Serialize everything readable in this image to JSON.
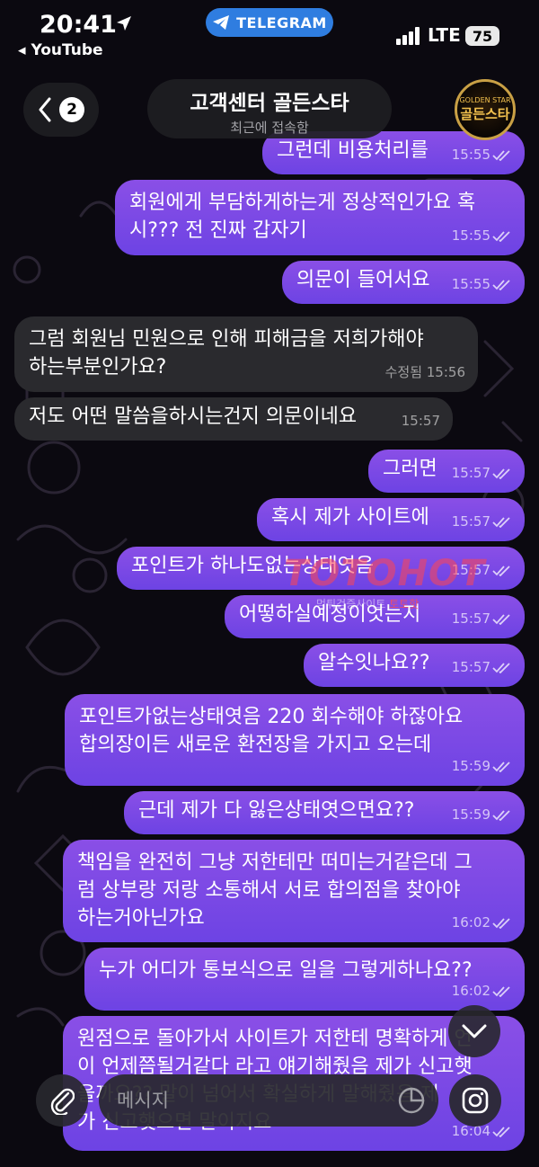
{
  "status_bar": {
    "time": "20:41",
    "back_app": "◂ YouTube",
    "telegram_label": "TELEGRAM",
    "network": "LTE",
    "battery": "75"
  },
  "header": {
    "back_count": "2",
    "title": "고객센터 골든스타",
    "subtitle": "최근에 접속함",
    "avatar_text": "골든스타",
    "avatar_top_text": "GOLDEN STAR"
  },
  "watermark": {
    "main": "TOTOHOT",
    "sub": "먹튀검증사이트",
    "sub2": "토토핫"
  },
  "messages": [
    {
      "dir": "out",
      "text": "그런데 비용처리를",
      "time": "15:55",
      "check": true
    },
    {
      "dir": "out",
      "text": "회원에게 부담하게하는게 정상적인가요 혹\n시??? 전 진짜 갑자기",
      "time": "15:55",
      "check": true
    },
    {
      "dir": "out",
      "text": "의문이 들어서요",
      "time": "15:55",
      "check": true
    },
    {
      "dir": "in",
      "text": "그럼 회원님 민원으로 인해 피해금을 저희가해야\n하는부분인가요?",
      "time": "수정됨 15:56",
      "check": false
    },
    {
      "dir": "in",
      "text": "저도 어떤 말씀을하시는건지 의문이네요",
      "time": "15:57",
      "check": false
    },
    {
      "dir": "out",
      "text": "그러면",
      "time": "15:57",
      "check": true
    },
    {
      "dir": "out",
      "text": "혹시 제가 사이트에",
      "time": "15:57",
      "check": true
    },
    {
      "dir": "out",
      "text": "포인트가 하나도없는상태엿음",
      "time": "15:57",
      "check": true
    },
    {
      "dir": "out",
      "text": "어떻하실예정이엇는지",
      "time": "15:57",
      "check": true
    },
    {
      "dir": "out",
      "text": "알수잇나요??",
      "time": "15:57",
      "check": true
    },
    {
      "dir": "out",
      "text": "포인트가없는상태엿음 220 회수해야 하잖아요\n합의장이든 새로운 환전장을 가지고 오는데",
      "time": "15:59",
      "check": true
    },
    {
      "dir": "out",
      "text": "근데 제가 다 잃은상태엿으면요??",
      "time": "15:59",
      "check": true
    },
    {
      "dir": "out",
      "text": "책임을 완전히 그냥 저한테만 떠미는거같은데 그\n럼 상부랑 저랑 소통해서 서로 합의점을 찾아야\n하는거아닌가요",
      "time": "16:02",
      "check": true
    },
    {
      "dir": "out",
      "text": "누가 어디가 통보식으로 일을 그렇게하나요??",
      "time": "16:02",
      "check": true
    },
    {
      "dir": "out",
      "text": "원점으로 돌아가서 사이트가 저한테 명확하게 언\n이 언제쯤될거같다 라고 얘기해줬음 제가 신고햇\n을까요?? 말이 넘어서 확실하게 말해줬음 제\n가 신고햇으면 말이지요",
      "time": "16:04",
      "check": true
    }
  ],
  "composer": {
    "placeholder": "메시지"
  }
}
